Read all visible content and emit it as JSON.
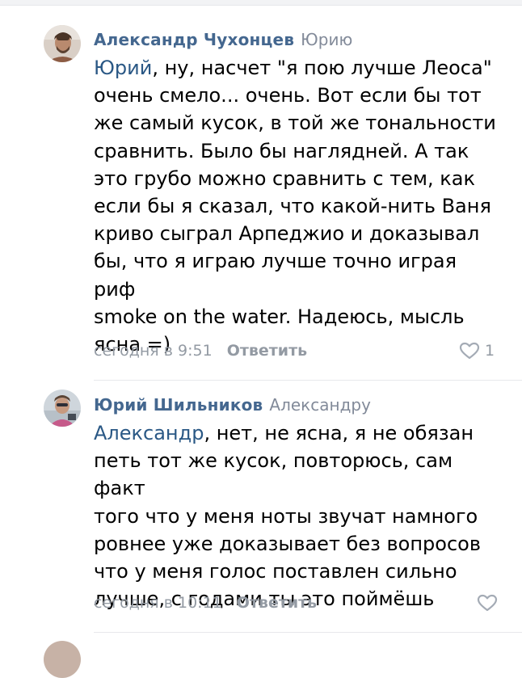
{
  "comments": [
    {
      "author": "Александр Чухонцев",
      "reply_to": "Юрию",
      "mention": "Юрий",
      "text_lines": [
        ", ну, насчет \"я пою лучше Леоса\"",
        "очень смело... очень. Вот если бы тот",
        "же самый кусок, в той же тональности",
        "сравнить. Было бы наглядней. А так",
        "это грубо можно сравнить с тем, как",
        "если бы я сказал, что какой-нить Ваня",
        "криво сыграл Арпеджио и доказывал",
        "бы, что я играю лучше точно играя риф",
        "smoke on the water. Надеюсь, мысль",
        "ясна =)"
      ],
      "date": "сегодня в 9:51",
      "reply_label": "Ответить",
      "likes": "1",
      "avatar_icon": "user-photo"
    },
    {
      "author": "Юрий Шильников",
      "reply_to": "Александру",
      "mention": "Александр",
      "text_lines": [
        ", нет, не ясна, я не обязан",
        "петь тот же кусок, повторюсь, сам факт",
        "того что у меня ноты звучат намного",
        "ровнее уже доказывает без вопросов",
        "что у меня голос поставлен сильно",
        "лучше, с годами ты это поймёшь"
      ],
      "date": "сегодня в 10:11",
      "reply_label": "Ответить",
      "likes": "",
      "avatar_icon": "user-photo"
    }
  ],
  "colors": {
    "author": "#44678f",
    "mention": "#2a5885",
    "meta": "#939aa3",
    "heart": "#a4abb5"
  }
}
